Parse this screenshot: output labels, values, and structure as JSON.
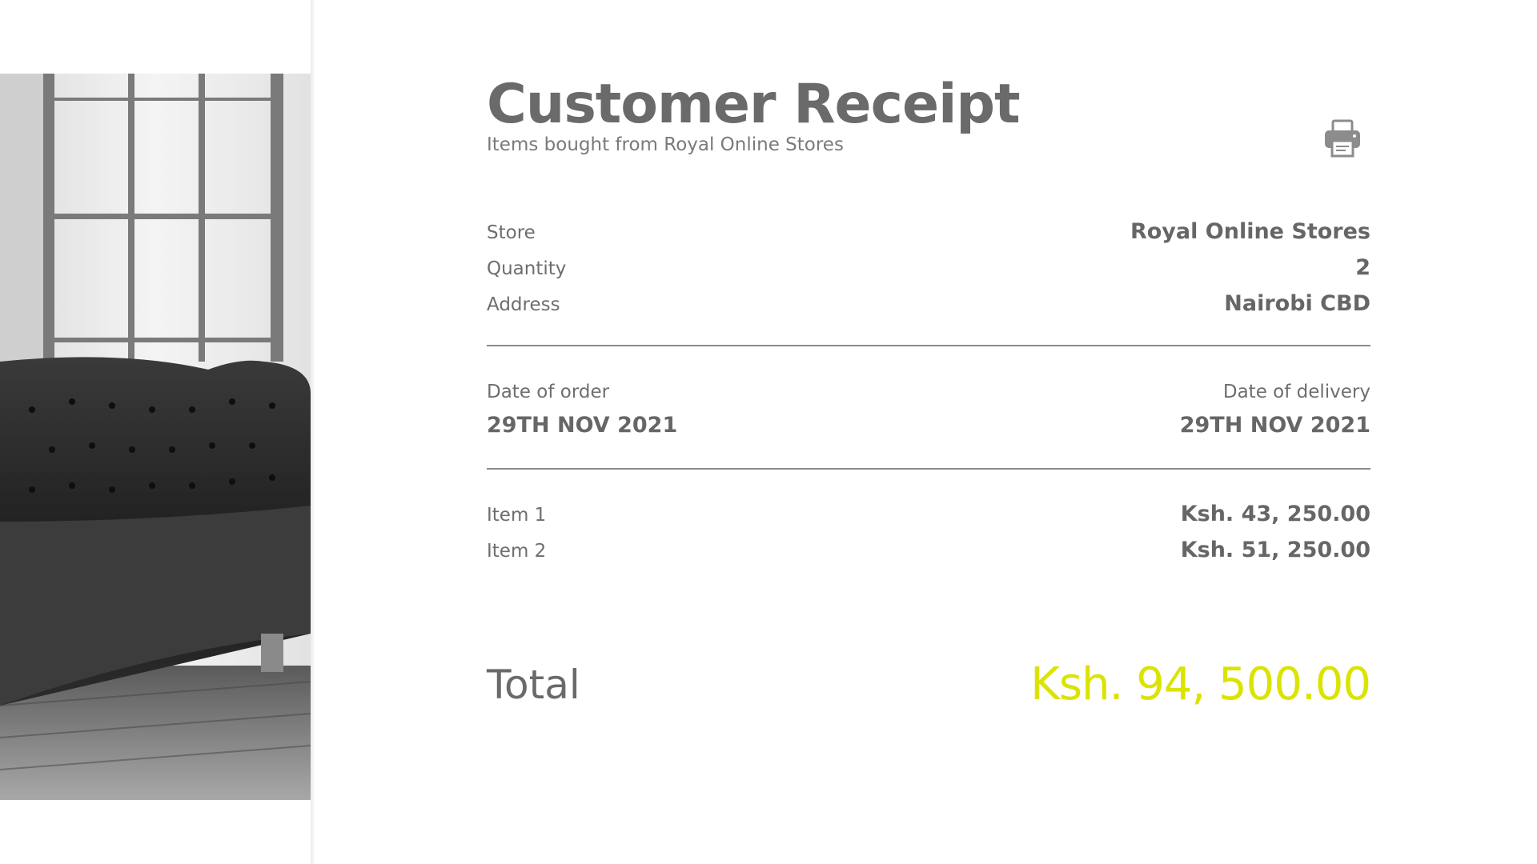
{
  "header": {
    "title": "Customer Receipt",
    "subtitle": "Items bought from Royal Online Stores",
    "print_icon": "printer-icon"
  },
  "info": {
    "store_label": "Store",
    "store_value": "Royal Online Stores",
    "quantity_label": "Quantity",
    "quantity_value": "2",
    "address_label": "Address",
    "address_value": "Nairobi CBD"
  },
  "dates": {
    "order_label": "Date of order",
    "order_value": "29TH NOV 2021",
    "delivery_label": "Date of delivery",
    "delivery_value": "29TH NOV 2021"
  },
  "items": [
    {
      "label": "Item 1",
      "price": "Ksh. 43, 250.00"
    },
    {
      "label": "Item 2",
      "price": "Ksh. 51, 250.00"
    }
  ],
  "total": {
    "label": "Total",
    "value": "Ksh. 94, 500.00"
  },
  "colors": {
    "accent": "#dbe300",
    "text": "#6a6a6a",
    "divider": "#8a8a8a"
  }
}
